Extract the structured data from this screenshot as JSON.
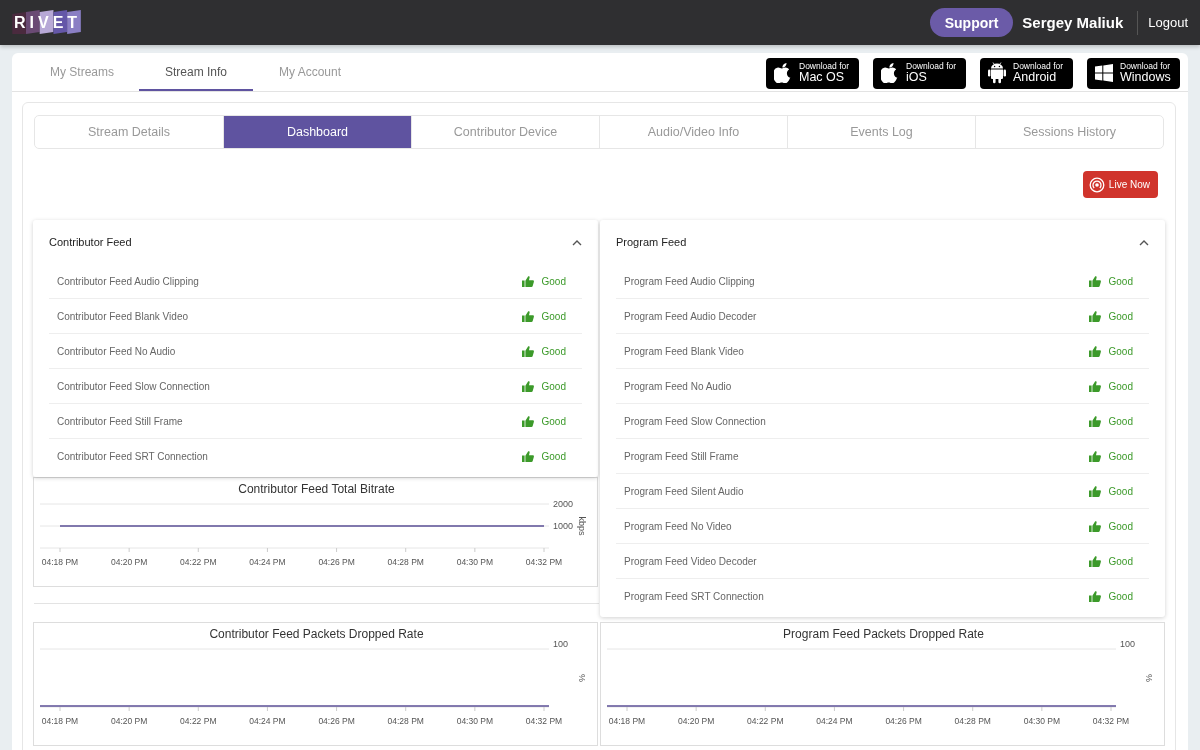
{
  "header": {
    "logo": "RIVET",
    "support_button": "Support",
    "user_name": "Sergey Maliuk",
    "logout": "Logout"
  },
  "nav_tabs": [
    {
      "label": "My Streams",
      "selected": false
    },
    {
      "label": "Stream Info",
      "selected": true
    },
    {
      "label": "My Account",
      "selected": false
    }
  ],
  "downloads": [
    {
      "kind": "apple",
      "caption": "Download for",
      "platform": "Mac OS"
    },
    {
      "kind": "apple",
      "caption": "Download for",
      "platform": "iOS"
    },
    {
      "kind": "android",
      "caption": "Download for",
      "platform": "Android"
    },
    {
      "kind": "windows",
      "caption": "Download for",
      "platform": "Windows"
    }
  ],
  "sub_tabs": [
    {
      "label": "Stream Details",
      "selected": false
    },
    {
      "label": "Dashboard",
      "selected": true
    },
    {
      "label": "Contributor Device",
      "selected": false
    },
    {
      "label": "Audio/Video Info",
      "selected": false
    },
    {
      "label": "Events Log",
      "selected": false
    },
    {
      "label": "Sessions History",
      "selected": false
    }
  ],
  "live_button": "Live Now",
  "panels": [
    {
      "title": "Contributor Feed",
      "expanded": true,
      "checks": [
        {
          "name": "Contributor Feed Audio Clipping",
          "status": "Good",
          "kind": "good"
        },
        {
          "name": "Contributor Feed Blank Video",
          "status": "Good",
          "kind": "good"
        },
        {
          "name": "Contributor Feed No Audio",
          "status": "Good",
          "kind": "good"
        },
        {
          "name": "Contributor Feed Slow Connection",
          "status": "Good",
          "kind": "good"
        },
        {
          "name": "Contributor Feed Still Frame",
          "status": "Good",
          "kind": "good"
        },
        {
          "name": "Contributor Feed SRT Connection",
          "status": "Good",
          "kind": "good"
        }
      ]
    },
    {
      "title": "Program Feed",
      "expanded": true,
      "checks": [
        {
          "name": "Program Feed Audio Clipping",
          "status": "Good",
          "kind": "good"
        },
        {
          "name": "Program Feed Audio Decoder",
          "status": "Good",
          "kind": "good"
        },
        {
          "name": "Program Feed Blank Video",
          "status": "Good",
          "kind": "good"
        },
        {
          "name": "Program Feed No Audio",
          "status": "Good",
          "kind": "good"
        },
        {
          "name": "Program Feed Slow Connection",
          "status": "Good",
          "kind": "good"
        },
        {
          "name": "Program Feed Still Frame",
          "status": "Good",
          "kind": "good"
        },
        {
          "name": "Program Feed Silent Audio",
          "status": "Good",
          "kind": "good"
        },
        {
          "name": "Program Feed No Video",
          "status": "Good",
          "kind": "good"
        },
        {
          "name": "Program Feed Video Decoder",
          "status": "Good",
          "kind": "good"
        },
        {
          "name": "Program Feed SRT Connection",
          "status": "Good",
          "kind": "good"
        }
      ]
    }
  ],
  "charts": [
    {
      "chart_data": {
        "type": "line",
        "title": "Contributor Feed Total Bitrate",
        "ylabel": "kbps",
        "categories": [
          "04:18 PM",
          "04:20 PM",
          "04:22 PM",
          "04:24 PM",
          "04:26 PM",
          "04:28 PM",
          "04:30 PM",
          "04:32 PM"
        ],
        "ylim": [
          0,
          2000
        ],
        "yticks": [
          1000,
          2000
        ],
        "series": [
          {
            "color": "#5b4f96",
            "values": [
              1000,
              1000,
              1000,
              1000,
              1000,
              1000,
              1000,
              1000
            ]
          }
        ]
      }
    },
    {
      "title": "Contributor Feed Packets Dropped Rate",
      "top_tick": "100",
      "ylabel": "%",
      "x_labels": [
        "04:18 PM",
        "04:20 PM",
        "04:22 PM",
        "04:24 PM",
        "04:26 PM",
        "04:28 PM",
        "04:30 PM",
        "04:32 PM"
      ]
    },
    {
      "title": "Program Feed Packets Dropped Rate",
      "top_tick": "100",
      "ylabel": "%",
      "x_labels": [
        "04:18 PM",
        "04:20 PM",
        "04:22 PM",
        "04:24 PM",
        "04:26 PM",
        "04:28 PM",
        "04:30 PM",
        "04:32 PM"
      ]
    }
  ]
}
